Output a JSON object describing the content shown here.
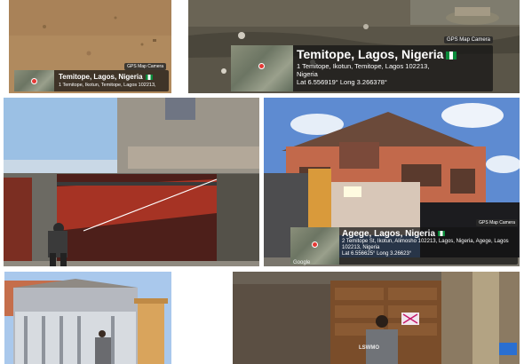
{
  "photos": [
    {
      "stamp": {
        "badge": "GPS Map Camera",
        "place": "Temitope, Lagos, Nigeria",
        "address": "1 Temitope, Ikotun, Temitope, Lagos 102213,",
        "coords": ""
      }
    },
    {
      "stamp": {
        "badge": "GPS Map Camera",
        "place": "Temitope, Lagos, Nigeria",
        "address": "1 Temitope, Ikotun, Temitope, Lagos 102213, Nigeria",
        "coords": "Lat 6.556919° Long 3.266378°"
      }
    },
    {},
    {
      "stamp": {
        "badge": "GPS Map Camera",
        "place": "Agege, Lagos, Nigeria",
        "address": "2 Temitope St, Ikotun, Alimosho 102213, Lagos, Nigeria, Agege, Lagos 102213, Nigeria",
        "coords": "Lat 6.556625° Long 3.26623°"
      },
      "watermark": "Google"
    },
    {},
    {
      "shirt_text": "LSWMO"
    }
  ]
}
